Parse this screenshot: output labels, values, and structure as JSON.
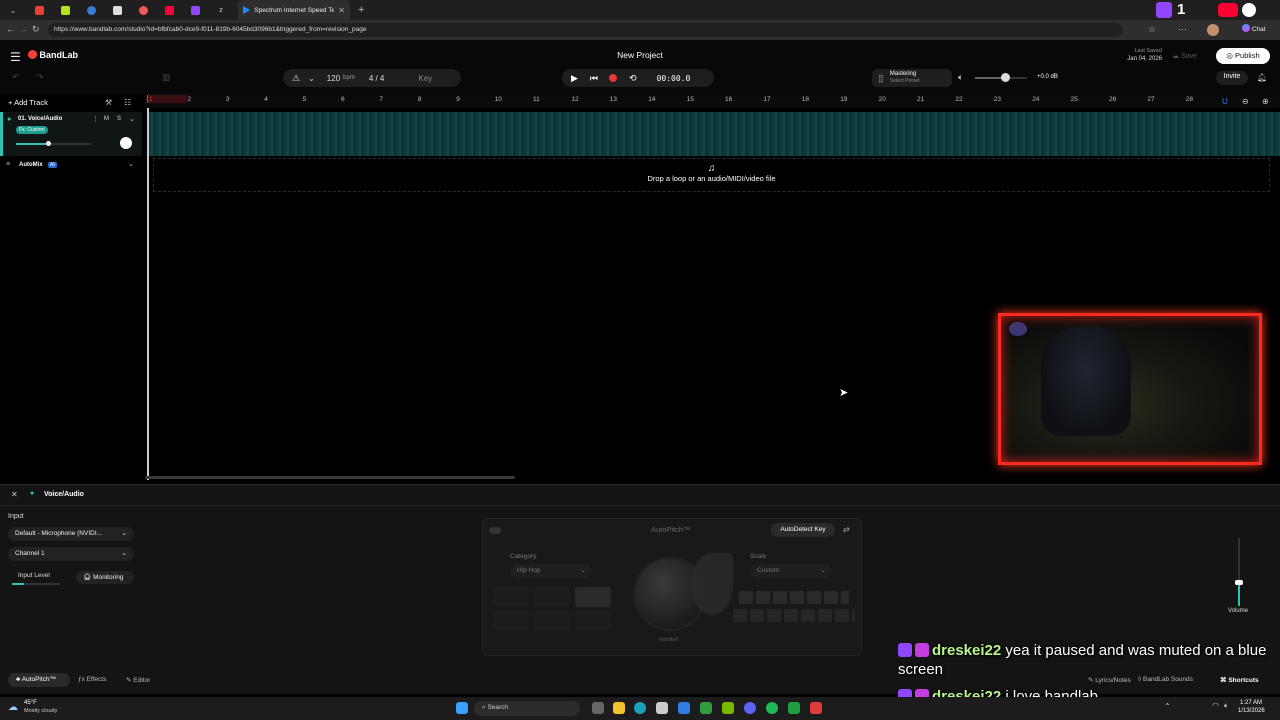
{
  "browser": {
    "tab_title": "Spectrum Internet Speed Test| Bro",
    "url": "https://www.bandlab.com/studio?id=bfbfcab0-dce9-f011-819b-6045bd3096b1&triggered_from=revision_page",
    "chat_label": "Chat"
  },
  "header": {
    "logo": "BandLab",
    "project_title": "New Project",
    "bpm_value": "120",
    "bpm_unit": "bpm",
    "time_signature": "4 / 4",
    "key_label": "Key",
    "time_display": "00:00.0",
    "mastering_label": "Mastering",
    "mastering_preset": "Select Preset",
    "volume_db": "+0.0 dB",
    "last_saved_label": "Last Saved",
    "last_saved_date": "Jan 04, 2026",
    "save_label": "Save",
    "publish_label": "Publish",
    "invite_label": "Invite"
  },
  "toolbar": {
    "add_track_label": "Add Track"
  },
  "ruler": {
    "marks": [
      "1",
      "2",
      "3",
      "4",
      "5",
      "6",
      "7",
      "8",
      "9",
      "10",
      "11",
      "12",
      "13",
      "14",
      "15",
      "16",
      "17",
      "18",
      "19",
      "20",
      "21",
      "22",
      "23",
      "24",
      "25",
      "26",
      "27",
      "28"
    ]
  },
  "track": {
    "name": "01. Voice/Audio",
    "fx_badge": "Fx: Custom",
    "mute": "M",
    "solo": "S",
    "automix_label": "AutoMix",
    "automix_badge": "AI"
  },
  "drop_zone": {
    "text": "Drop a loop or an audio/MIDI/video file"
  },
  "panel": {
    "title": "Voice/Audio",
    "input_label": "Input",
    "input_device": "Default - Microphone (NVIDI...",
    "channel": "Channel 1",
    "input_level_label": "Input Level",
    "monitoring_label": "Monitoring",
    "autopitch_title": "AutoPitch™",
    "autodetect_label": "AutoDetect Key",
    "category_label": "Category",
    "category_value": "Hip Hop",
    "scale_label": "Scale",
    "scale_value": "Custom",
    "knob_label": "Hardtail",
    "volume_label": "Volume",
    "tabs": [
      "AutoPitch™",
      "Effects",
      "Editor"
    ],
    "lyrics_label": "Lyrics/Notes",
    "sounds_label": "BandLab Sounds",
    "shortcuts_label": "Shortcuts"
  },
  "chat": [
    {
      "user": "dreskei22",
      "message": "yea it paused and was muted on a blue screen"
    },
    {
      "user": "dreskei22",
      "message": "i love bandlab"
    }
  ],
  "taskbar": {
    "weather_temp": "45°F",
    "weather_desc": "Mostly cloudy",
    "search_placeholder": "Search",
    "time": "1:27 AM",
    "date": "1/13/2026"
  },
  "overlay_counter": "1",
  "colors": {
    "accent": "#2fc3b3",
    "record": "#e53935",
    "webcam_border": "#ff2a1f",
    "chat_user": "#b9f48a",
    "twitch": "#9146ff"
  }
}
